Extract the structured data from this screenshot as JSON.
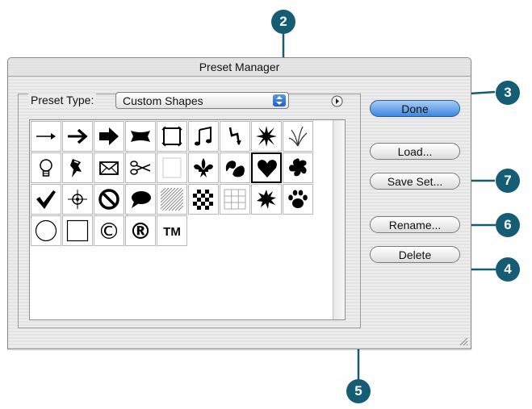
{
  "window": {
    "title": "Preset Manager"
  },
  "preset_type": {
    "label": "Preset Type:",
    "value": "Custom Shapes"
  },
  "buttons": {
    "done": "Done",
    "load": "Load...",
    "save_set": "Save Set...",
    "rename": "Rename...",
    "delete": "Delete"
  },
  "shapes": [
    {
      "icon": "thin-arrow-icon"
    },
    {
      "icon": "arrow-icon"
    },
    {
      "icon": "bold-arrow-icon"
    },
    {
      "icon": "banner-icon"
    },
    {
      "icon": "frame-icon"
    },
    {
      "icon": "music-note-icon"
    },
    {
      "icon": "lightning-icon"
    },
    {
      "icon": "starburst-icon"
    },
    {
      "icon": "grass-icon"
    },
    {
      "icon": "lightbulb-icon"
    },
    {
      "icon": "pushpin-icon"
    },
    {
      "icon": "envelope-icon"
    },
    {
      "icon": "scissors-icon"
    },
    {
      "icon": "blank-frame-icon"
    },
    {
      "icon": "fleur-de-lis-icon"
    },
    {
      "icon": "ornament-icon"
    },
    {
      "icon": "heart-icon",
      "selected": true
    },
    {
      "icon": "splat-icon"
    },
    {
      "icon": "checkmark-icon"
    },
    {
      "icon": "target-icon"
    },
    {
      "icon": "no-sign-icon"
    },
    {
      "icon": "speech-bubble-icon"
    },
    {
      "icon": "diagonal-lines-icon"
    },
    {
      "icon": "checkerboard-icon"
    },
    {
      "icon": "grid-icon"
    },
    {
      "icon": "burst-icon"
    },
    {
      "icon": "paw-print-icon"
    },
    {
      "icon": "circle-icon"
    },
    {
      "icon": "square-icon"
    },
    {
      "icon": "copyright-icon",
      "text": "©"
    },
    {
      "icon": "registered-icon",
      "text": "®"
    },
    {
      "icon": "trademark-icon",
      "text": "TM"
    }
  ],
  "callouts": {
    "c2": "2",
    "c3": "3",
    "c7": "7",
    "c6": "6",
    "c4": "4",
    "c5": "5"
  },
  "colors": {
    "callout": "#145d75",
    "default_button": "#3e87e0"
  }
}
